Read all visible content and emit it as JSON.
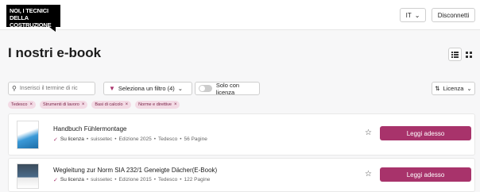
{
  "header": {
    "logo_line1": "NOI, I TECNICI",
    "logo_line2": "DELLA COSTRUZIONE",
    "language": "IT",
    "disconnect_label": "Disconnetti"
  },
  "main": {
    "title": "I nostri e-book",
    "search_placeholder": "Inserisci il termine di ric",
    "filter_label": "Seleziona un filtro (4)",
    "license_toggle_label": "Solo con licenza",
    "sort_label": "Licenza",
    "active_filters": [
      "Tedesco",
      "Strumenti di lavoro",
      "Basi di calcolo",
      "Norme e direttive"
    ]
  },
  "books": [
    {
      "title": "Handbuch Fühlermontage",
      "license": "Su licenza",
      "publisher": "suissetec",
      "edition": "Edizione 2025",
      "language": "Tedesco",
      "pages": "56 Pagine",
      "action": "Leggi adesso"
    },
    {
      "title": "Wegleitung zur Norm SIA 232/1 Geneigte Dächer(E-Book)",
      "license": "Su licenza",
      "publisher": "suissetec",
      "edition": "Edizione 2015",
      "language": "Tedesco",
      "pages": "122 Pagine",
      "action": "Leggi adesso"
    }
  ],
  "colors": {
    "accent": "#a8336b",
    "chip_bg": "#f3dbe5"
  },
  "icons": {
    "search": "search-icon",
    "filter": "funnel-icon",
    "sort": "sort-icon",
    "favorite": "star-icon",
    "list_view": "list-view-icon",
    "grid_view": "grid-view-icon",
    "dropdown": "chevron-down-icon"
  }
}
